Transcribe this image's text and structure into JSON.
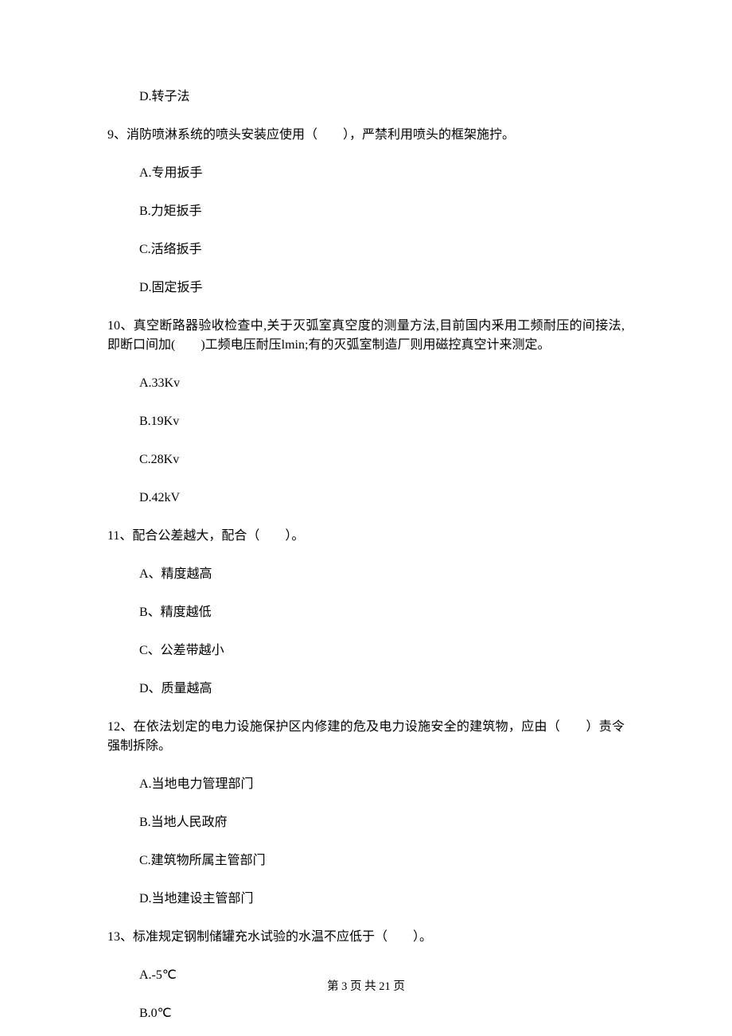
{
  "q8": {
    "optD": "D.转子法"
  },
  "q9": {
    "stem": "9、消防喷淋系统的喷头安装应使用（　　），严禁利用喷头的框架施拧。",
    "optA": "A.专用扳手",
    "optB": "B.力矩扳手",
    "optC": "C.活络扳手",
    "optD": "D.固定扳手"
  },
  "q10": {
    "stem": "10、真空断路器验收检查中,关于灭弧室真空度的测量方法,目前国内釆用工频耐压的间接法,即断口间加(　　)工频电压耐压lmin;有的灭弧室制造厂则用磁控真空计来测定。",
    "optA": "A.33Kv",
    "optB": "B.19Kv",
    "optC": "C.28Kv",
    "optD": "D.42kV"
  },
  "q11": {
    "stem": "11、配合公差越大，配合（　　）。",
    "optA": "A、精度越高",
    "optB": "B、精度越低",
    "optC": "C、公差带越小",
    "optD": "D、质量越高"
  },
  "q12": {
    "stem": "12、在依法划定的电力设施保护区内修建的危及电力设施安全的建筑物，应由（　　）责令强制拆除。",
    "optA": "A.当地电力管理部门",
    "optB": "B.当地人民政府",
    "optC": "C.建筑物所属主管部门",
    "optD": "D.当地建设主管部门"
  },
  "q13": {
    "stem": "13、标准规定钢制储罐充水试验的水温不应低于（　　）。",
    "optA": "A.-5℃",
    "optB": "B.0℃"
  },
  "footer": "第 3 页 共 21 页"
}
